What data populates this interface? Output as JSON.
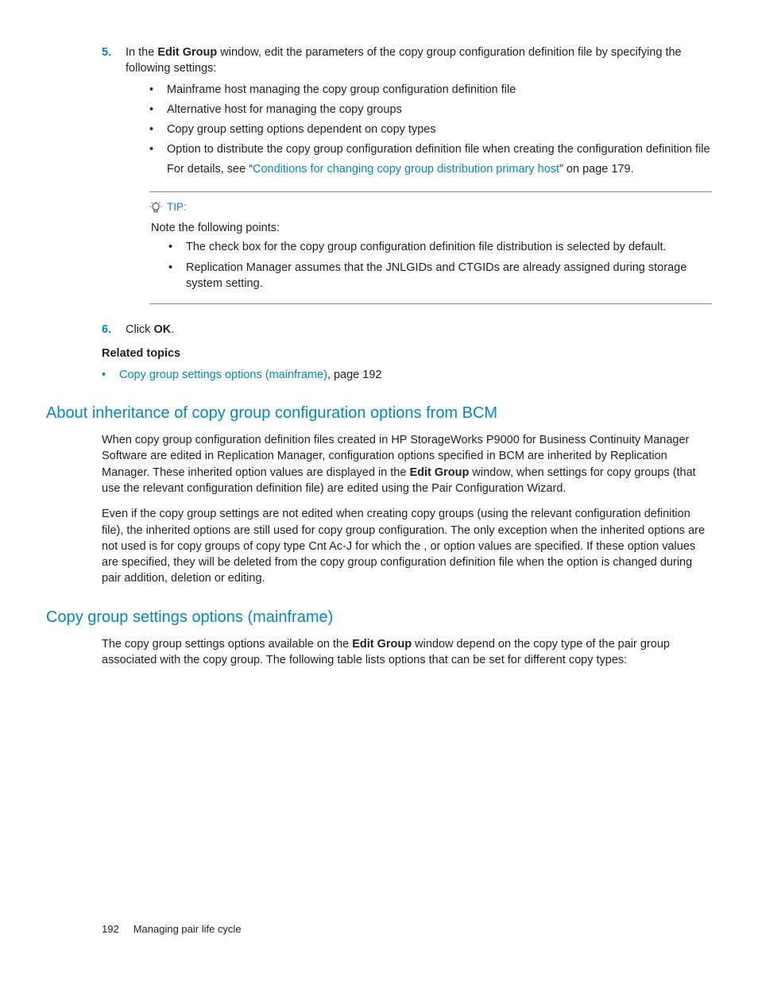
{
  "step5": {
    "num": "5.",
    "intro_pre": "In the ",
    "intro_bold": "Edit Group",
    "intro_post": " window, edit the parameters of the copy group configuration definition file by specifying the following settings:",
    "bullets": [
      "Mainframe host managing the copy group configuration definition file",
      "Alternative host for managing the copy groups",
      "Copy group setting options dependent on copy types",
      "Option to distribute the copy group configuration definition file when creating the configuration definition file"
    ],
    "bullet4_sub_pre": "For details, see “",
    "bullet4_sub_link": "Conditions for changing copy group distribution primary host",
    "bullet4_sub_post": "” on page 179."
  },
  "tip": {
    "label": "TIP:",
    "lead": "Note the following points:",
    "bullets": [
      "The check box for the copy group configuration definition file distribution is selected by default.",
      "Replication Manager assumes that the JNLGIDs and CTGIDs are already assigned during storage system setting."
    ]
  },
  "step6": {
    "num": "6.",
    "pre": "Click ",
    "bold": "OK",
    "post": "."
  },
  "related": {
    "heading": "Related topics",
    "item_link": "Copy group settings options (mainframe)",
    "item_post": ", page 192"
  },
  "sectionA": {
    "title": "About inheritance of copy group configuration options from BCM",
    "p1_pre": "When copy group configuration definition files created in HP StorageWorks P9000 for Business Continuity Manager Software are edited in Replication Manager, configuration options specified in BCM are inherited by Replication Manager. These inherited option values are displayed in the ",
    "p1_bold": "Edit Group",
    "p1_post": " window, when settings for copy groups (that use the relevant configuration definition file) are edited using the Pair Configuration Wizard.",
    "p2": "Even if the copy group settings are not edited when creating copy groups (using the relevant configuration definition file), the inherited options are still used for copy group configuration. The only exception when the inherited options are not used is for copy groups of copy type Cnt Ac-J for which the                      ,                              or                                   option values are specified. If these option values are specified, they will be deleted from the copy group configuration definition file when the option is changed during pair addition, deletion or editing."
  },
  "sectionB": {
    "title": "Copy group settings options (mainframe)",
    "p1_pre": "The copy group settings options available on the ",
    "p1_bold": "Edit Group",
    "p1_post": " window depend on the copy type of the pair group associated with the copy group. The following table lists options that can be set for different copy types:"
  },
  "footer": {
    "page": "192",
    "chapter": "Managing pair life cycle"
  }
}
